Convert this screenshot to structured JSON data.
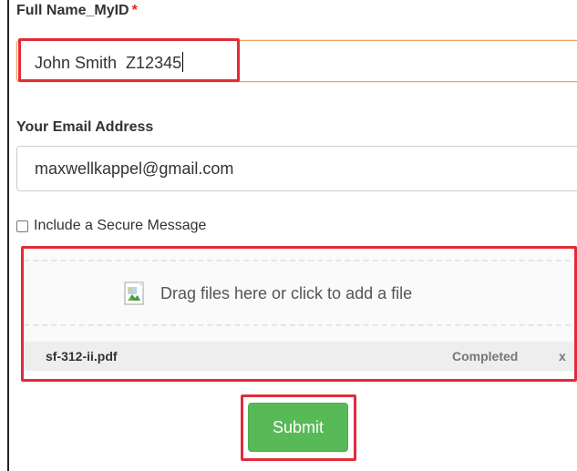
{
  "form": {
    "full_name": {
      "label": "Full Name_MyID",
      "required_marker": "*",
      "value": "John Smith  Z12345",
      "focused": true
    },
    "email": {
      "label": "Your Email Address",
      "value": "maxwellkappel@gmail.com"
    },
    "secure_message": {
      "label": "Include a Secure Message",
      "checked": false
    },
    "upload": {
      "drop_text": "Drag files here or click to add a file",
      "files": [
        {
          "name": "sf-312-ii.pdf",
          "status": "Completed",
          "remove_label": "x"
        }
      ]
    },
    "submit_label": "Submit"
  },
  "colors": {
    "required": "#e0281c",
    "highlight": "#e32b3b",
    "submit": "#58b957",
    "focus_border": "#f0a060"
  },
  "icons": {
    "drop_image": "broken-image-icon"
  }
}
